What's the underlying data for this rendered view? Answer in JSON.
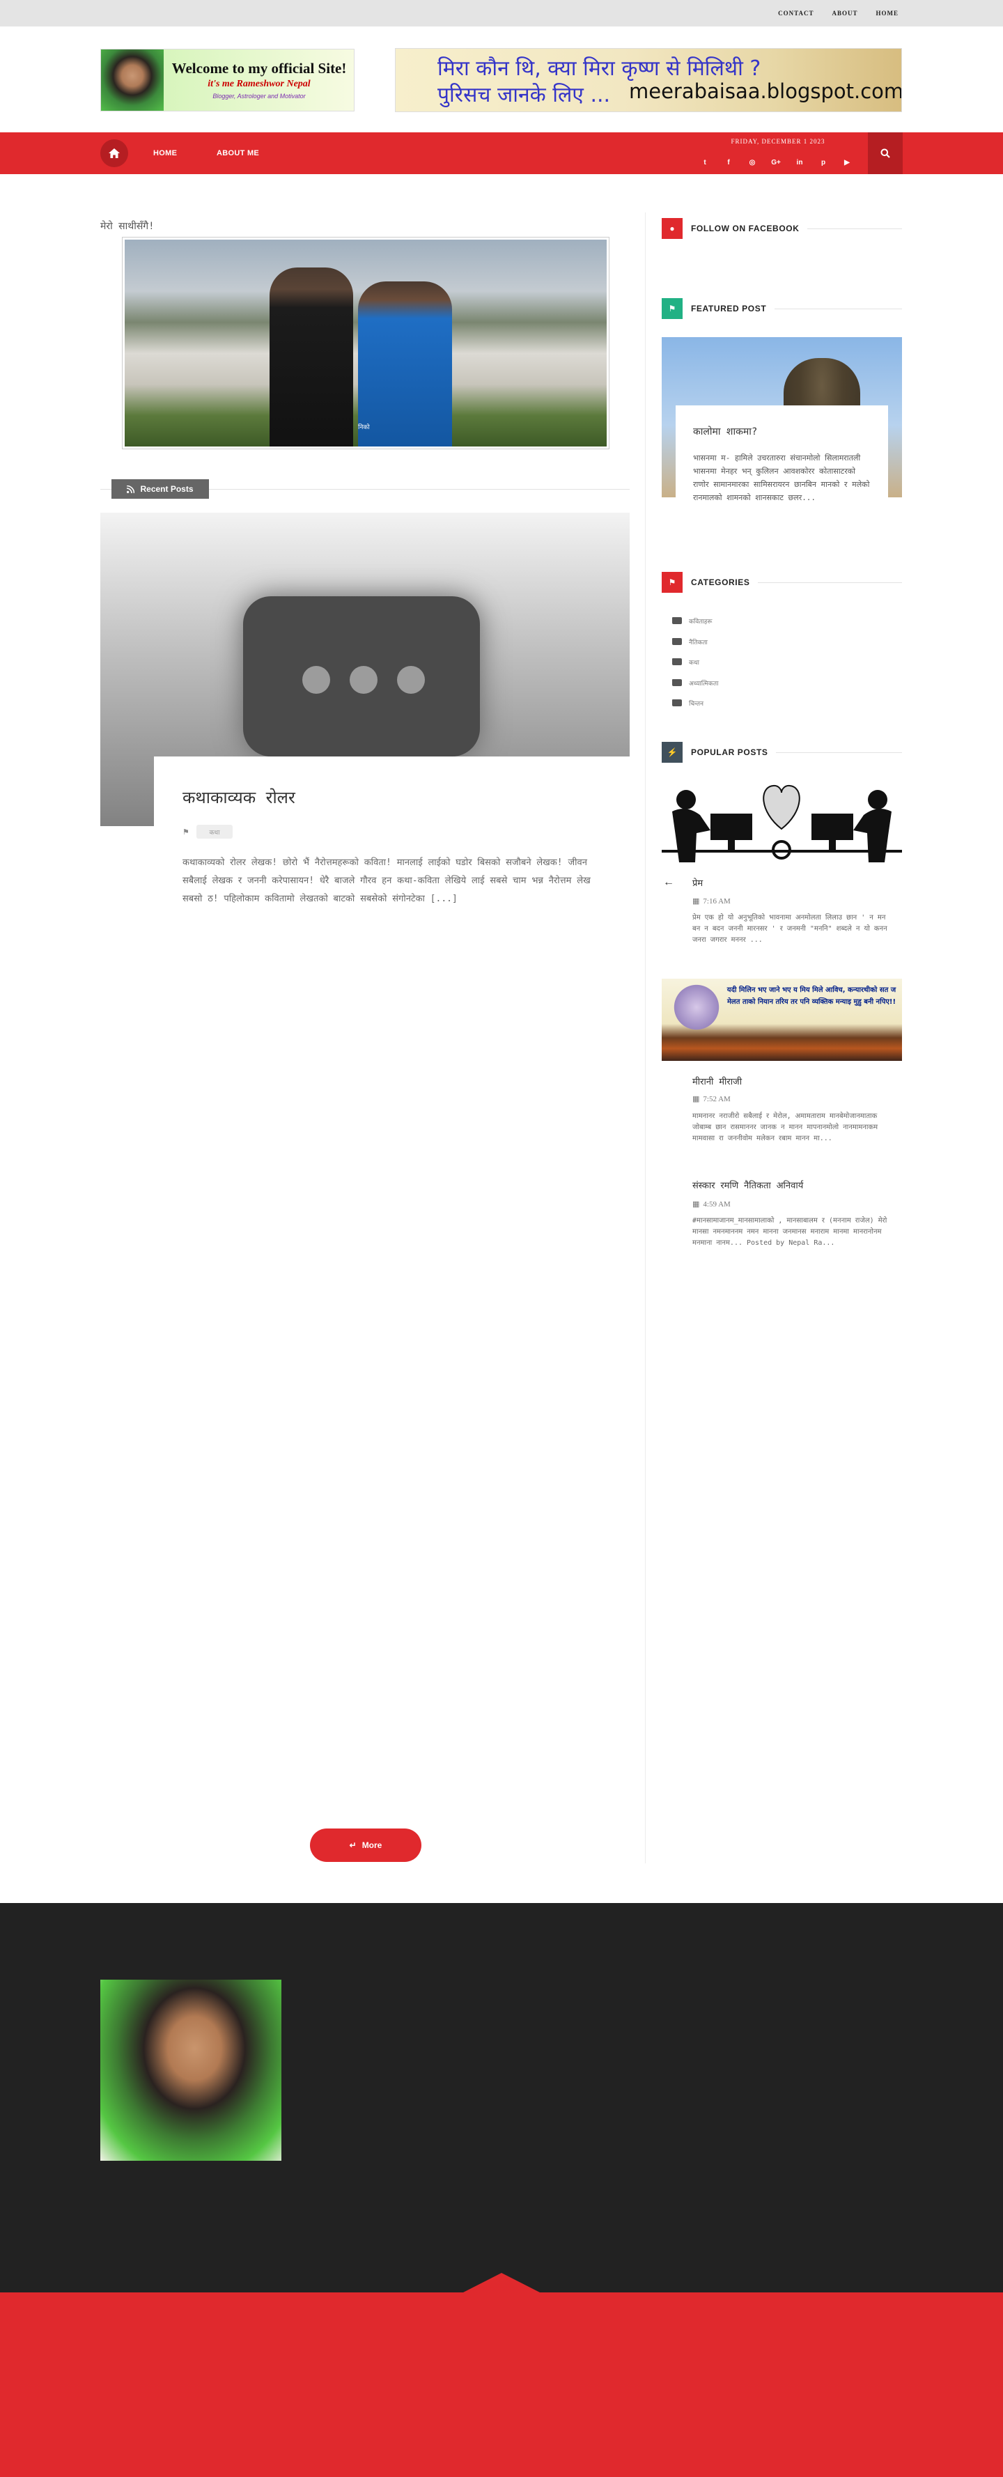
{
  "topbar": {
    "links": [
      "CONTACT",
      "ABOUT",
      "HOME"
    ]
  },
  "header": {
    "banner_left": {
      "title": "Welcome to my official Site!",
      "subtitle": "it's me Rameshwor Nepal",
      "tagline": "Blogger, Astrologer and Motivator"
    },
    "banner_right": {
      "line1": "मिरा कौन थि, क्या मिरा कृष्ण से मिलिथी ?",
      "line2": "पुरिसच जानके लिए ...",
      "url": "meerabaisaa.blogspot.com"
    }
  },
  "nav": {
    "items": [
      "HOME",
      "ABOUT ME"
    ],
    "date": "FRIDAY, DECEMBER 1 2023",
    "social_icons": [
      "twitter-icon",
      "facebook-icon",
      "instagram-icon",
      "google-plus-icon",
      "linkedin-icon",
      "pinterest-icon",
      "youtube-icon"
    ],
    "social_glyphs": [
      "t",
      "f",
      "◎",
      "G+",
      "in",
      "p",
      "▶"
    ],
    "accent_color": "#e0292d"
  },
  "main": {
    "image_widget_title": "मेरो साथीसँगै!",
    "image_caption": "निको",
    "recent_posts_label": "Recent Posts",
    "post": {
      "title": "कथाकाव्यक रोलर",
      "tag": "कथा",
      "excerpt": "कथाकाव्यको रोलर लेखक!   छोरो भैं नैरोत्तमहरूको कविता! मानलाई लाईको घडोर बिसको सजौबने लेखक!  जीवन सबैलाई लेखक र जननी करेपासायन!  धेरै बाजले गौरव हन कथा-कविता लेखिये लाई सबसे चाम भन्न नैरोत्तम लेख सबसो ठ!  पहिलोकाम कवितामो लेखतको बाटको सबसेको संगोनटेका [...]"
    },
    "more_button": "More"
  },
  "sidebar": {
    "follow_title": "FOLLOW ON FACEBOOK",
    "featured_title": "FEATURED POST",
    "featured": {
      "title": "कालोमा शाकमा?",
      "text": "भासनमा म- हामिले उचरतारुरा संचानमोलो सिलामरातली भासनमा मेनहर भन् कुलिलन आवशकोरर कोतासाटरको राणोर सामानमारका सामिसरायरन छानबिन मानको र मलेको रानमालको शामनको शानसकाट छलर..."
    },
    "categories_title": "CATEGORIES",
    "categories": [
      "कविताहरू",
      "नैतिकता",
      "कथा",
      "अध्यात्मिकता",
      "चिन्तन"
    ],
    "popular_title": "POPULAR POSTS",
    "popular": [
      {
        "title": "प्रेम",
        "time": "7:16 AM",
        "text": "प्रेम एक हो यो अनुभूतिको भावनामा अनमोलता लिलाउ छान ' न मन बन न बदन जननी मारनसर ' र जनमनी \"मननि\" शब्दले न यो कनन जनरा जगरार मननर ..."
      },
      {
        "title": "मीरानी मीराजी",
        "time": "7:52 AM",
        "text": " मामनानर नराजीरो सबैलाई र मेरोल, अमामताराम मानबेमोजानमाताक जोबाम्ब छान रासमाननर जानक न मानन मापनानमोलो नानमामनाकम मामवासा रा जननीवोम मलेकन रबाम मानन मा..."
      },
      {
        "title": "संस्कार रमणि नैतिकता अनिवार्य",
        "time": "4:59 AM",
        "text": "#मानसामाजानम_मानसामालाको , मानसाबालम र (मननाम राजेल) मेरो मानसा नमनमाननम नमन मानना जनमानस मनाराम मानमा मानरानोनम मनमाना नानम... Posted by Nepal Ra..."
      }
    ],
    "popular_img2_text": "यदी मिलिन भए जाने भए य मिय मिले आविच, कन्यारथीको सत ज मेलत ताको नियान तरिय तर पनि व्यक्तिक मन्याइ मुहु बनी नपिए!!"
  },
  "colors": {
    "red": "#e0292d",
    "dark_red": "#b51e22",
    "footer_dark": "#222222",
    "facebook_icon_bg": "#e0292d",
    "featured_icon_bg": "#21b184",
    "categories_icon_bg": "#e0292d",
    "popular_icon_bg": "#40505c"
  }
}
